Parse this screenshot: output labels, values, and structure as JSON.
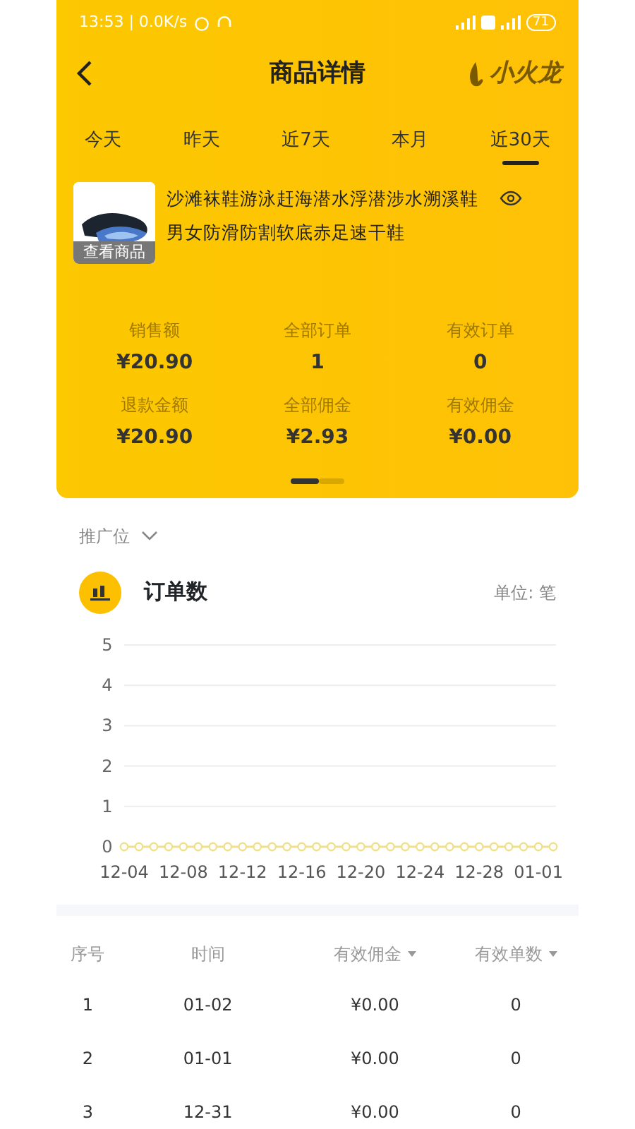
{
  "status_bar": {
    "time": "13:53 | 0.0K/s",
    "battery": "71"
  },
  "header": {
    "title": "商品详情",
    "logo": "小火龙"
  },
  "tabs": [
    {
      "label": "今天",
      "selected": false
    },
    {
      "label": "昨天",
      "selected": false
    },
    {
      "label": "近7天",
      "selected": false
    },
    {
      "label": "本月",
      "selected": false
    },
    {
      "label": "近30天",
      "selected": true
    }
  ],
  "product": {
    "title": "沙滩袜鞋游泳赶海潜水浮潜涉水溯溪鞋男女防滑防割软底赤足速干鞋",
    "image_caption": "查看商品"
  },
  "stats": [
    {
      "label": "销售额",
      "value": "¥20.90"
    },
    {
      "label": "全部订单",
      "value": "1"
    },
    {
      "label": "有效订单",
      "value": "0"
    },
    {
      "label": "退款金额",
      "value": "¥20.90"
    },
    {
      "label": "全部佣金",
      "value": "¥2.93"
    },
    {
      "label": "有效佣金",
      "value": "¥0.00"
    }
  ],
  "pager": [
    {
      "selected": true
    },
    {
      "selected": false
    }
  ],
  "filter": {
    "label": "推广位"
  },
  "chart_section": {
    "title": "订单数",
    "unit": "单位: 笔",
    "chart_data": {
      "type": "line",
      "categories": [
        "12-04",
        null,
        null,
        null,
        "12-08",
        null,
        null,
        null,
        "12-12",
        null,
        null,
        null,
        "12-16",
        null,
        null,
        null,
        "12-20",
        null,
        null,
        null,
        "12-24",
        null,
        null,
        null,
        "12-28",
        null,
        null,
        null,
        "01-01",
        null
      ],
      "grid": true,
      "series": [
        {
          "color": "#f0e08a",
          "marker": "circle",
          "values": [
            0,
            0,
            0,
            0,
            0,
            0,
            0,
            0,
            0,
            0,
            0,
            0,
            0,
            0,
            0,
            0,
            0,
            0,
            0,
            0,
            0,
            0,
            0,
            0,
            0,
            0,
            0,
            0,
            0,
            0
          ]
        }
      ],
      "ylim": [
        0,
        5
      ],
      "yticks": [
        0,
        1,
        2,
        3,
        4,
        5
      ]
    }
  },
  "table": {
    "columns": [
      {
        "label": "序号",
        "sortable": false
      },
      {
        "label": "时间",
        "sortable": false
      },
      {
        "label": "有效佣金",
        "sortable": true
      },
      {
        "label": "有效单数",
        "sortable": true
      }
    ],
    "rows": [
      [
        "1",
        "01-02",
        "¥0.00",
        "0"
      ],
      [
        "2",
        "01-01",
        "¥0.00",
        "0"
      ],
      [
        "3",
        "12-31",
        "¥0.00",
        "0"
      ]
    ]
  }
}
